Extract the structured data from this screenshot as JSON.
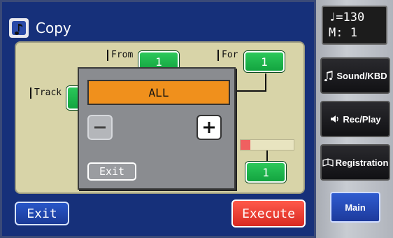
{
  "window": {
    "title": "Copy"
  },
  "fields": {
    "from_label": "From",
    "from_value": "1",
    "for_label": "For",
    "for_value": "1",
    "track_label": "Track",
    "bottom_value": "1"
  },
  "popup": {
    "value": "ALL",
    "minus_label": "−",
    "plus_label": "+",
    "exit_label": "Exit"
  },
  "footer": {
    "exit_label": "Exit",
    "execute_label": "Execute"
  },
  "side_panel": {
    "tempo_line": "♩=130",
    "measure_line": "M:  1",
    "sound_kbd_label": "Sound/KBD",
    "rec_play_label": "Rec/Play",
    "registration_label": "Registration",
    "main_label": "Main"
  },
  "colors": {
    "screen_bg": "#16307a",
    "panel_bg": "#d8d4a8",
    "value_green": "#13a440",
    "popup_value_orange": "#f0901c",
    "execute_red": "#d82a22"
  },
  "icons": {
    "app": "music-note-icon",
    "sound": "music-notes-icon",
    "rec_play": "speaker-icon",
    "registration": "book-icon"
  }
}
